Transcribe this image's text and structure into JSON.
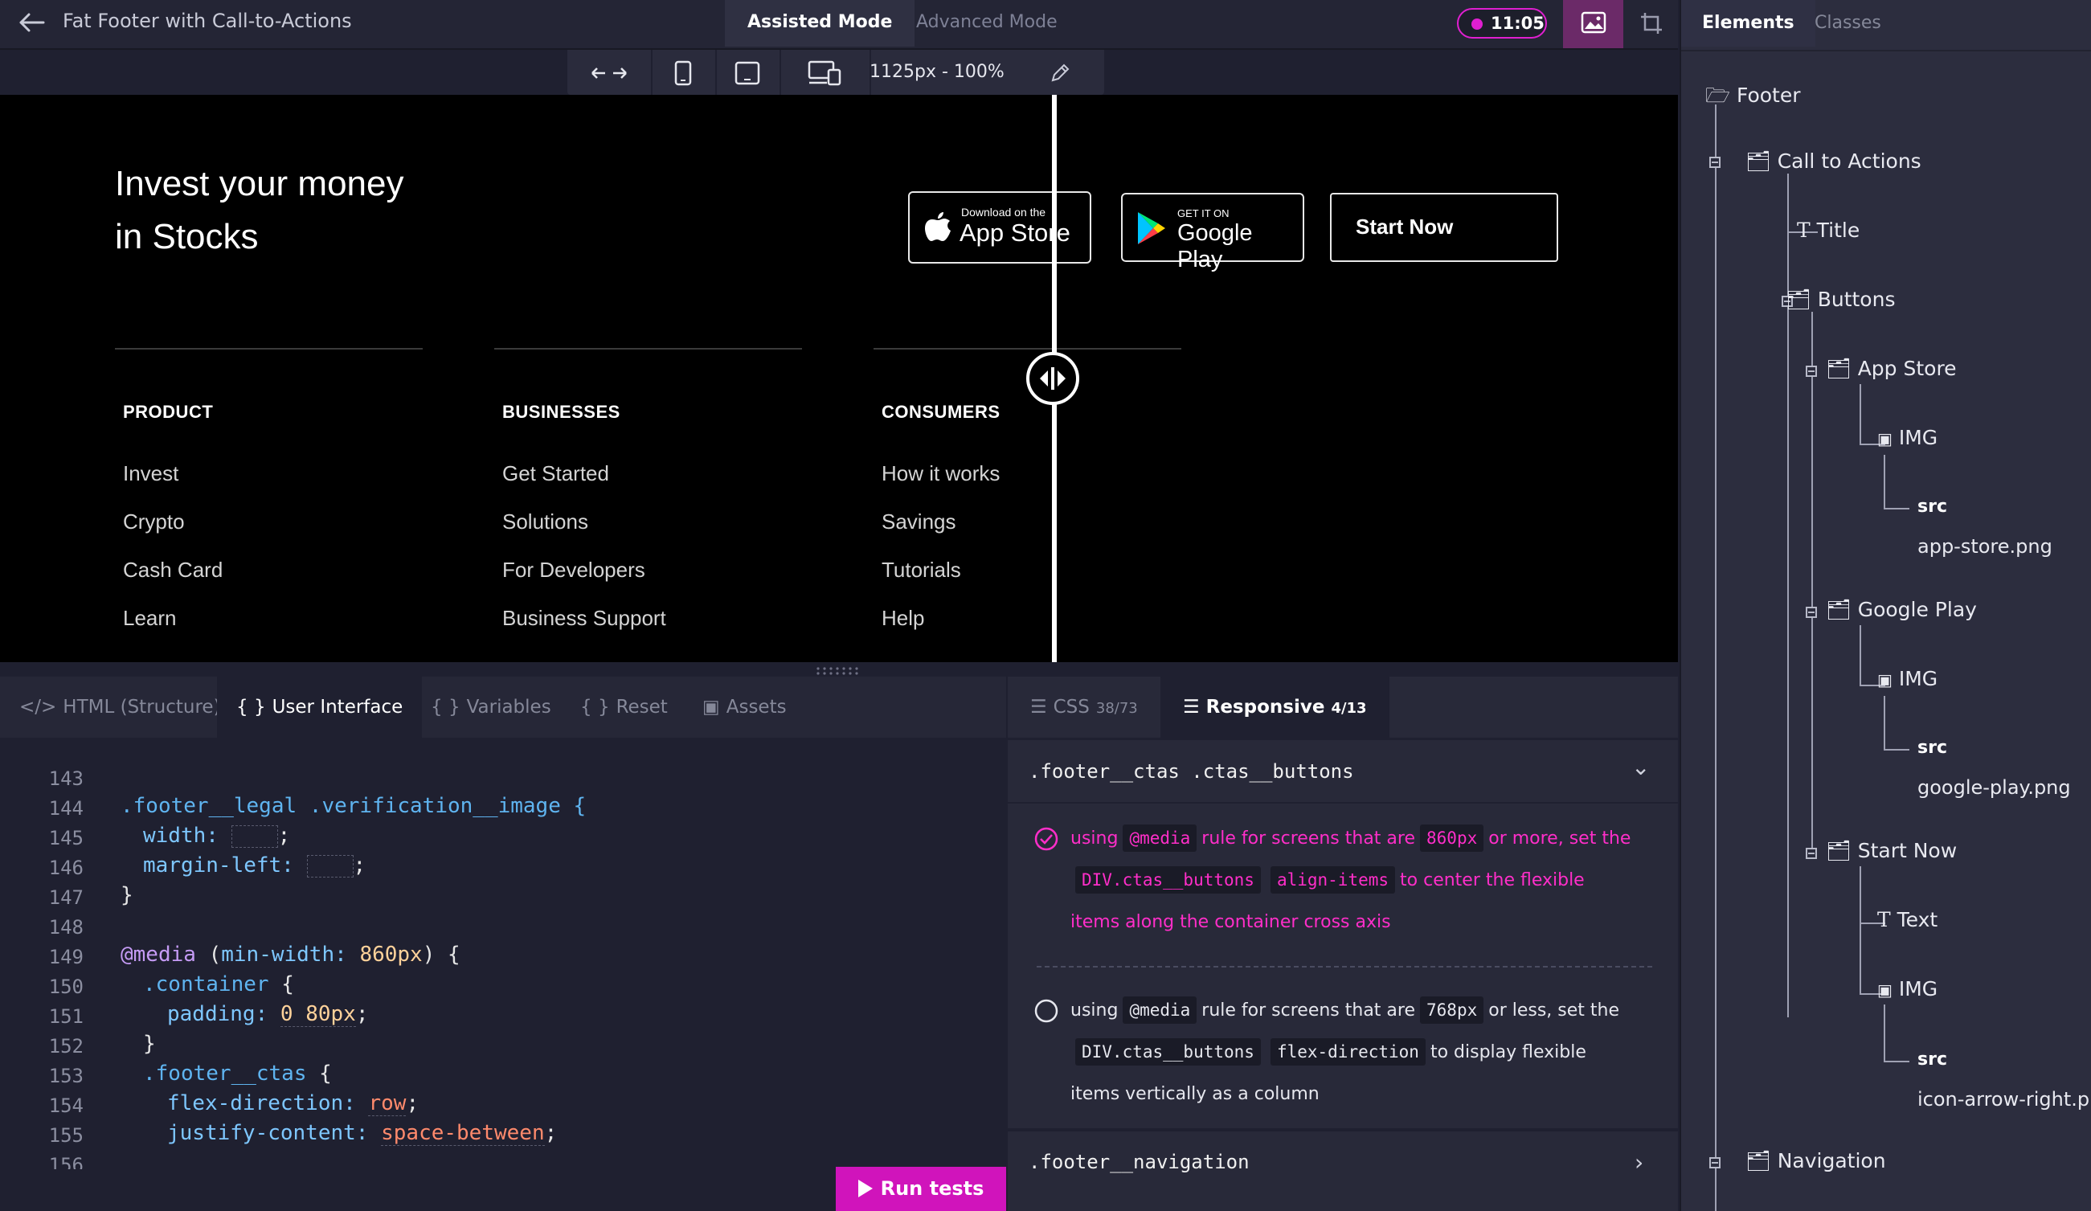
{
  "topbar": {
    "title": "Fat Footer with Call-to-Actions",
    "modes": [
      "Assisted Mode",
      "Advanced Mode"
    ],
    "active_mode": "Assisted Mode",
    "timer": "11:05",
    "accent": "#e01fd1"
  },
  "viewport": {
    "size_label": "1125px - 100%",
    "icons": [
      "resize-arrows-icon",
      "phone-icon",
      "tablet-icon",
      "responsive-devices-icon",
      "pencil-icon"
    ]
  },
  "preview": {
    "heading_line1": "Invest your money",
    "heading_line2": "in Stocks",
    "app_store": {
      "small": "Download on the",
      "big": "App Store"
    },
    "google_play": {
      "small": "GET IT ON",
      "big": "Google Play"
    },
    "start_now": "Start Now",
    "columns": [
      {
        "title": "PRODUCT",
        "items": [
          "Invest",
          "Crypto",
          "Cash Card",
          "Learn"
        ]
      },
      {
        "title": "BUSINESSES",
        "items": [
          "Get Started",
          "Solutions",
          "For Developers",
          "Business Support"
        ]
      },
      {
        "title": "CONSUMERS",
        "items": [
          "How it works",
          "Savings",
          "Tutorials",
          "Help"
        ]
      }
    ]
  },
  "editor_tabs": [
    "HTML (Structure)",
    "User Interface",
    "Variables",
    "Reset",
    "Assets"
  ],
  "editor_active_tab": "User Interface",
  "code": {
    "line_numbers": [
      "143",
      "144",
      "145",
      "146",
      "147",
      "148",
      "149",
      "150",
      "151",
      "152",
      "153",
      "154",
      "155",
      "156"
    ],
    "l144": ".footer__legal .verification__image {",
    "l145_prop": "width:",
    "l146_prop": "margin-left:",
    "l147": "}",
    "l149_at": "@media",
    "l149_open": "(",
    "l149_prop": "min-width:",
    "l149_val": "860px",
    "l149_close": ") {",
    "l150_sel": ".container",
    "l150_brace": "{",
    "l151_prop": "padding:",
    "l151_val": "0 80px",
    "l152": "}",
    "l153_sel": ".footer__ctas",
    "l153_brace": "{",
    "l154_prop": "flex-direction:",
    "l154_val": "row",
    "l155_prop": "justify-content:",
    "l155_val": "space-between",
    "semicolon": ";"
  },
  "run_tests": "Run tests",
  "tests": {
    "tabs": [
      {
        "label": "CSS",
        "count": "38/73"
      },
      {
        "label": "Responsive",
        "count": "4/13"
      }
    ],
    "active_tab": "Responsive",
    "rule1": ".footer__ctas .ctas__buttons",
    "t1": {
      "w1": "using",
      "c1": "@media",
      "w2": "rule for screens that are",
      "c2": "860px",
      "w3": "or more, set the",
      "c3": "DIV.ctas__buttons",
      "c4": "align-items",
      "w4": "to center the flexible",
      "w5": "items along the container cross axis",
      "passed": true
    },
    "t2": {
      "w1": "using",
      "c1": "@media",
      "w2": "rule for screens that are",
      "c2": "768px",
      "w3": "or less, set the",
      "c3": "DIV.ctas__buttons",
      "c4": "flex-direction",
      "w4": "to display flexible",
      "w5": "items vertically as a column",
      "passed": false
    },
    "rule2": ".footer__navigation",
    "pass_color": "#ff2ec9"
  },
  "sidebar": {
    "tabs": [
      "Elements",
      "Classes"
    ],
    "active_tab": "Elements",
    "tree": {
      "footer": "Footer",
      "cta": "Call to Actions",
      "title": "Title",
      "buttons": "Buttons",
      "app_store": "App Store",
      "img1": "IMG",
      "src1_label": "src",
      "src1_value": "app-store.png",
      "google_play": "Google Play",
      "img2": "IMG",
      "src2_label": "src",
      "src2_value": "google-play.png",
      "start_now": "Start Now",
      "text": "Text",
      "img3": "IMG",
      "src3_label": "src",
      "src3_value": "icon-arrow-right.png",
      "navigation": "Navigation"
    }
  }
}
